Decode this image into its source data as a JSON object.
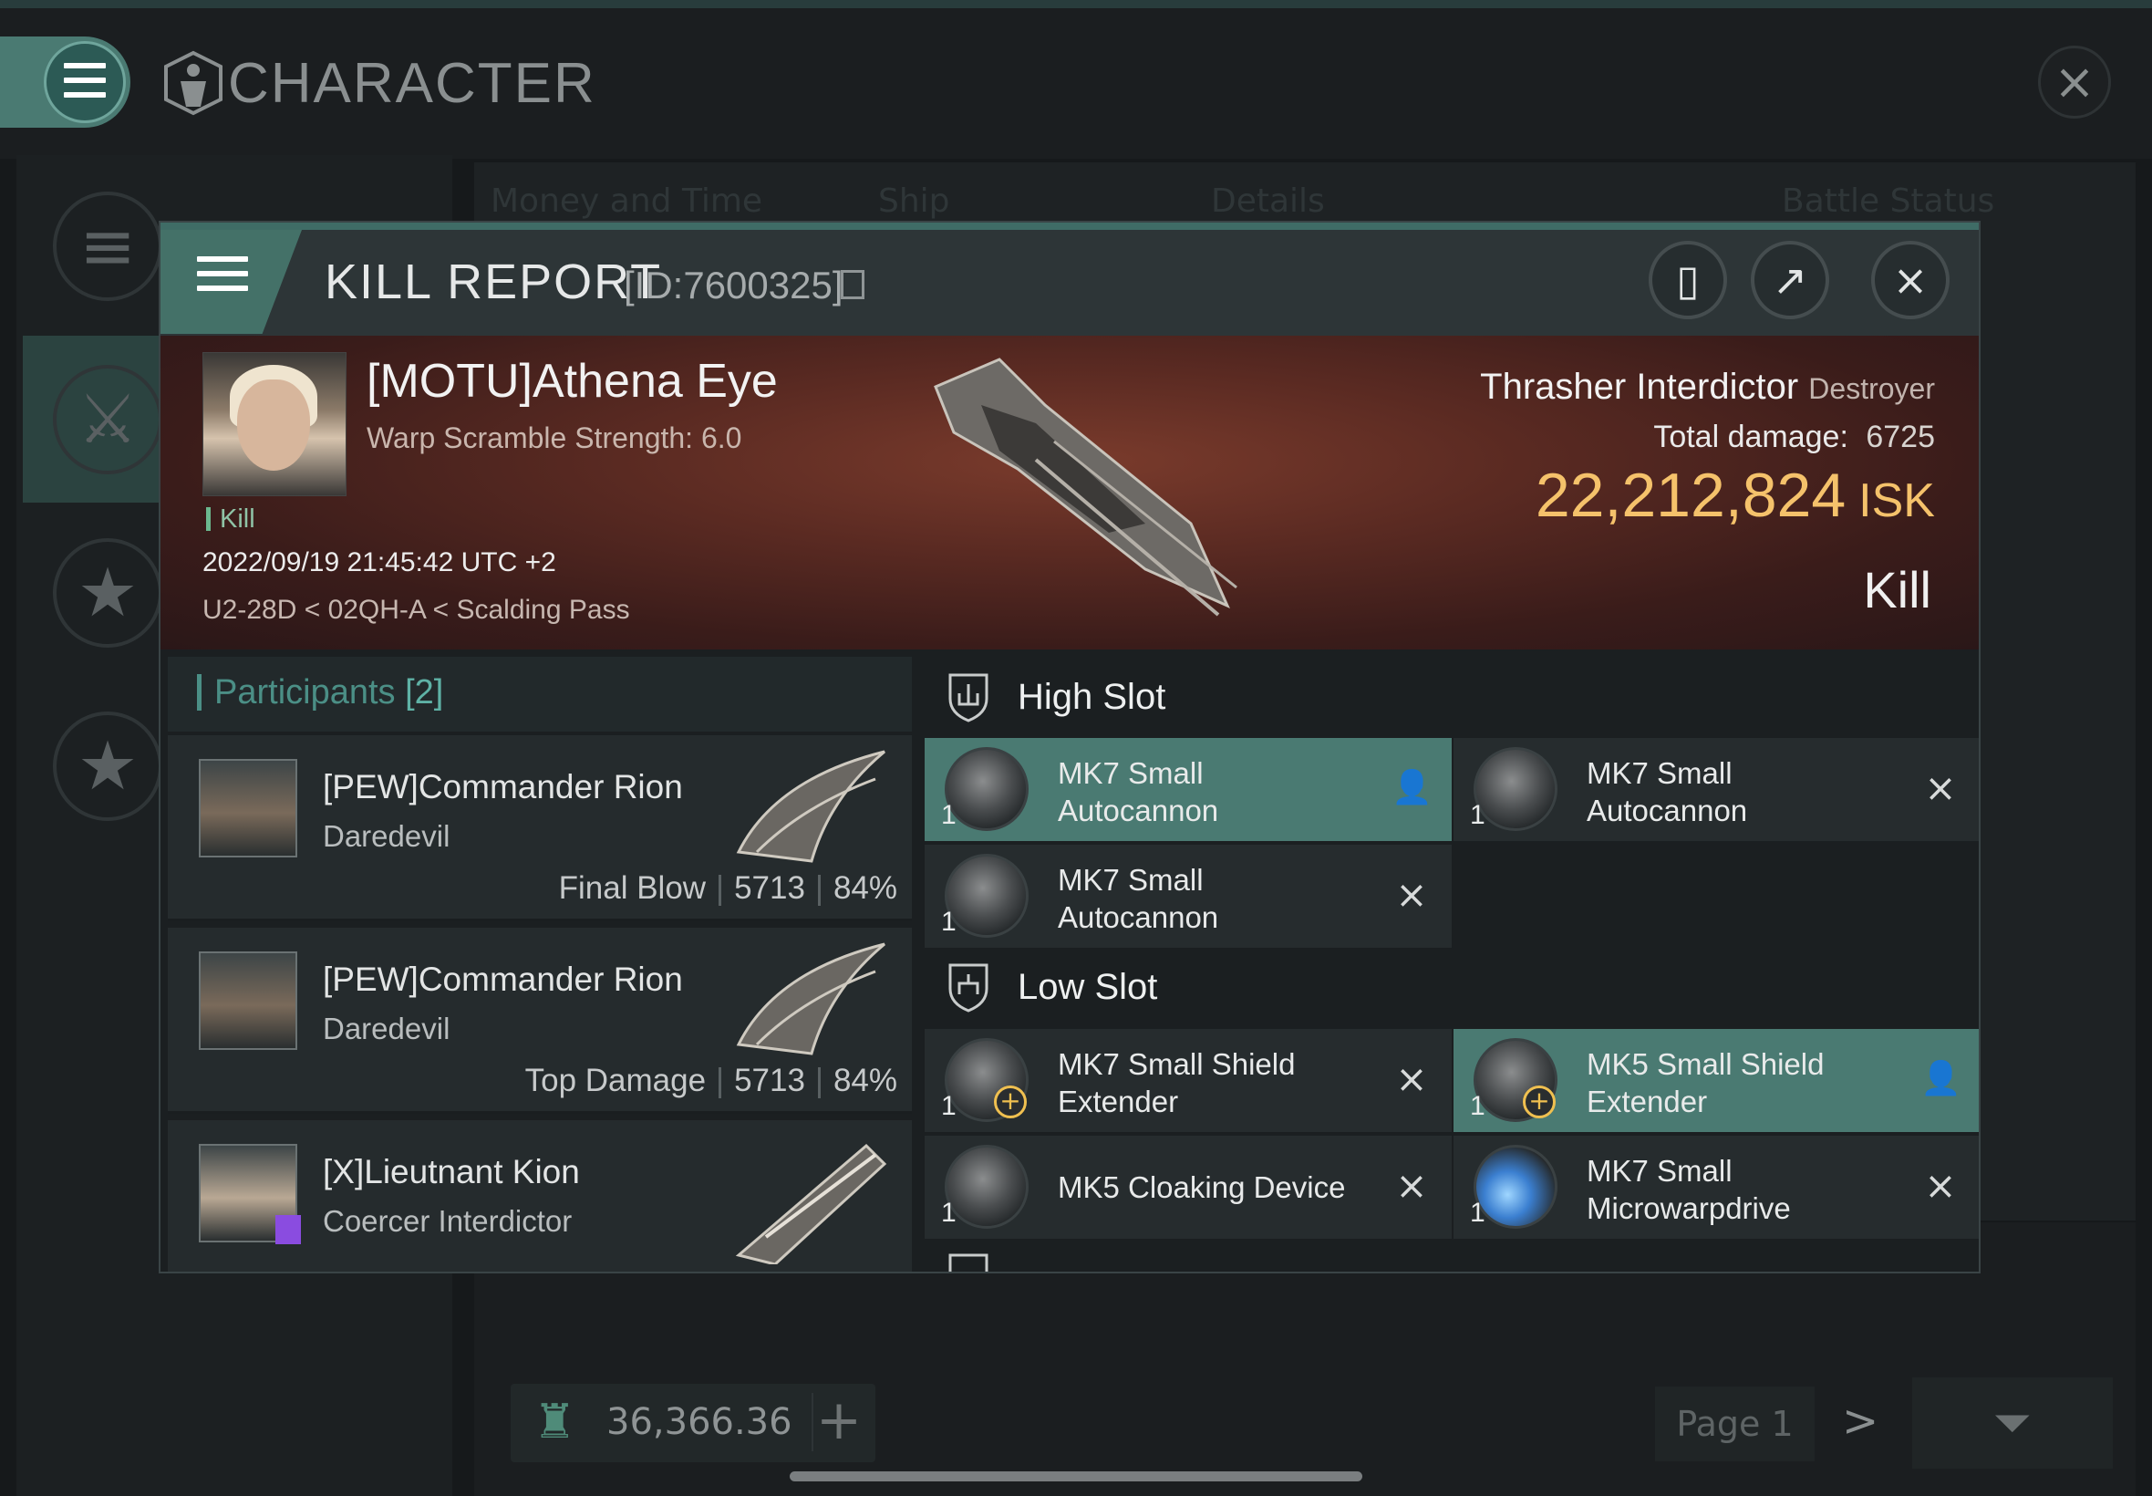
{
  "background": {
    "window_title": "CHARACTER",
    "columns": [
      "Money and Time",
      "Ship",
      "Details",
      "Battle Status"
    ],
    "wallet_value": "36,366.36",
    "page_label": "Page 1"
  },
  "kill_report": {
    "title": "KILL REPORT",
    "id_label": "[ID:7600325]",
    "victim": {
      "name": "[MOTU]Athena Eye",
      "warp_scramble": "Warp Scramble Strength: 6.0",
      "tag": "Kill",
      "datetime": "2022/09/19 21:45:42 UTC +2",
      "location": "U2-28D < 02QH-A < Scalding Pass"
    },
    "ship": {
      "name": "Thrasher Interdictor",
      "class": "Destroyer",
      "total_damage_label": "Total damage:",
      "total_damage": "6725",
      "isk_value": "22,212,824",
      "isk_unit": "ISK",
      "result": "Kill"
    },
    "participants": {
      "label": "Participants",
      "count": "[2]",
      "rows": [
        {
          "name": "[PEW]Commander Rion",
          "ship": "Daredevil",
          "role": "Final Blow",
          "damage": "5713",
          "percent": "84%"
        },
        {
          "name": "[PEW]Commander Rion",
          "ship": "Daredevil",
          "role": "Top Damage",
          "damage": "5713",
          "percent": "84%"
        },
        {
          "name": "[X]Lieutnant Kion",
          "ship": "Coercer Interdictor"
        }
      ]
    },
    "high_slot": {
      "label": "High Slot",
      "items": [
        {
          "name": "MK7 Small Autocannon",
          "qty": "1",
          "status": "person-icon",
          "highlight": true
        },
        {
          "name": "MK7 Small Autocannon",
          "qty": "1",
          "status": "destroyed-x-icon",
          "highlight": false
        },
        {
          "name": "MK7 Small Autocannon",
          "qty": "1",
          "status": "destroyed-x-icon",
          "highlight": false
        }
      ]
    },
    "low_slot": {
      "label": "Low Slot",
      "items": [
        {
          "name": "MK7 Small Shield Extender",
          "qty": "1",
          "status": "destroyed-x-icon",
          "highlight": false
        },
        {
          "name": "MK5 Small Shield Extender",
          "qty": "1",
          "status": "person-icon",
          "highlight": true
        },
        {
          "name": "MK5 Cloaking Device",
          "qty": "1",
          "status": "destroyed-x-icon",
          "highlight": false
        },
        {
          "name": "MK7 Small Microwarpdrive",
          "qty": "1",
          "status": "destroyed-x-icon",
          "highlight": false
        }
      ]
    }
  },
  "colors": {
    "accent_teal": "#4a7a72",
    "isk_gold": "#f5c26b",
    "banner_red": "#5a2a22"
  }
}
